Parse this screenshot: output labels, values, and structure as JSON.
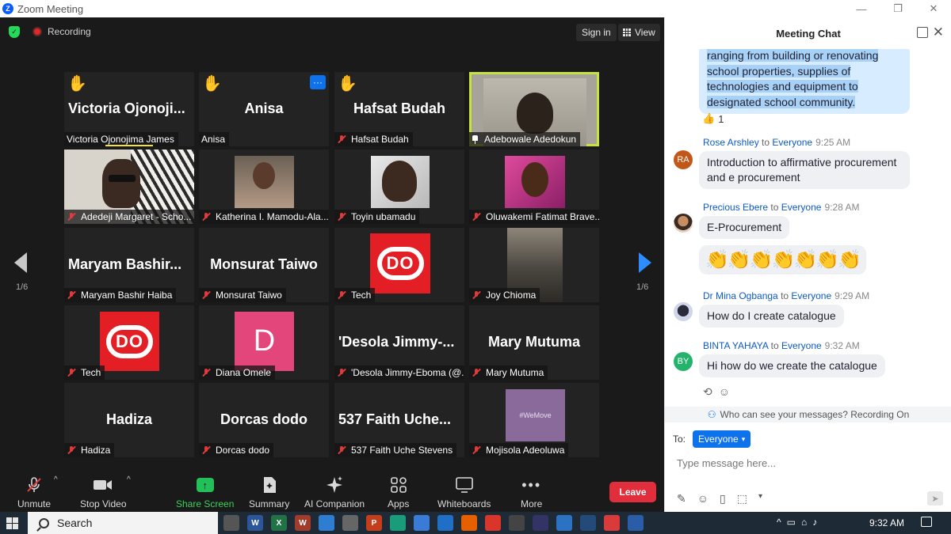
{
  "window": {
    "title": "Zoom Meeting",
    "logo_letter": "Z"
  },
  "topbar": {
    "recording_label": "Recording",
    "signin_label": "Sign in",
    "view_label": "View"
  },
  "grid": {
    "page_left": "1/6",
    "page_right": "1/6",
    "tiles": [
      {
        "big": "Victoria  Ojonoji...",
        "label": "Victoria Ojonojima James",
        "hand": "✋"
      },
      {
        "big": "Anisa",
        "label": "Anisa",
        "hand": "✋",
        "more": "···"
      },
      {
        "big": "Hafsat Budah",
        "label": "Hafsat Budah",
        "hand": "✋"
      },
      {
        "label": "Adebowale Adedokun"
      },
      {
        "label": "Adedeji Margaret - Scho..."
      },
      {
        "label": "Katherina I. Mamodu-Ala..."
      },
      {
        "label": "Toyin ubamadu"
      },
      {
        "label": "Oluwakemi Fatimat Brave..."
      },
      {
        "big": "Maryam  Bashir...",
        "label": "Maryam Bashir Haiba"
      },
      {
        "big": "Monsurat Taiwo",
        "label": "Monsurat Taiwo"
      },
      {
        "label": "Tech",
        "logo": "DO"
      },
      {
        "label": "Joy Chioma"
      },
      {
        "label": "Tech",
        "logo": "DO"
      },
      {
        "label": "Diana Omele",
        "initial": "D"
      },
      {
        "big": "'Desola  Jimmy-...",
        "label": "'Desola Jimmy-Eboma (@..."
      },
      {
        "big": "Mary Mutuma",
        "label": "Mary Mutuma"
      },
      {
        "big": "Hadiza",
        "label": "Hadiza"
      },
      {
        "big": "Dorcas dodo",
        "label": "Dorcas dodo"
      },
      {
        "big": "537 Faith  Uche...",
        "label": "537 Faith Uche Stevens"
      },
      {
        "label": "Mojisola Adeoluwa",
        "banner": "#WeMove"
      }
    ]
  },
  "toolbar": {
    "unmute": "Unmute",
    "stop_video": "Stop Video",
    "share_screen": "Share Screen",
    "summary": "Summary",
    "ai_companion": "AI Companion",
    "apps": "Apps",
    "whiteboards": "Whiteboards",
    "more": "More",
    "leave": "Leave"
  },
  "chat": {
    "title": "Meeting Chat",
    "first_bubble_lines": [
      "ranging from building or renovating",
      "school properties, supplies of",
      "technologies and equipment to",
      "designated school community."
    ],
    "reaction": {
      "emoji": "👍",
      "count": "1"
    },
    "messages": [
      {
        "sender": "Rose Arshley",
        "to": "to",
        "audience": "Everyone",
        "time": "9:25 AM",
        "initials": "RA",
        "text": "Introduction to affirmative procurement and e procurement"
      },
      {
        "sender": "Precious Ebere",
        "to": "to",
        "audience": "Everyone",
        "time": "9:28 AM",
        "text": "E-Procurement",
        "extra": "👏👏👏👏👏👏👏"
      },
      {
        "sender": "Dr Mina Ogbanga",
        "to": "to",
        "audience": "Everyone",
        "time": "9:29 AM",
        "text": "How do I create catalogue"
      },
      {
        "sender": "BINTA YAHAYA",
        "to": "to",
        "audience": "Everyone",
        "time": "9:32 AM",
        "initials": "BY",
        "text": "Hi how do we create the catalogue"
      }
    ],
    "privacy_note": "Who can see your messages? Recording On",
    "to_label": "To:",
    "to_value": "Everyone",
    "input_placeholder": "Type message here..."
  },
  "taskbar": {
    "search_label": "Search",
    "clock": "9:32 AM"
  }
}
